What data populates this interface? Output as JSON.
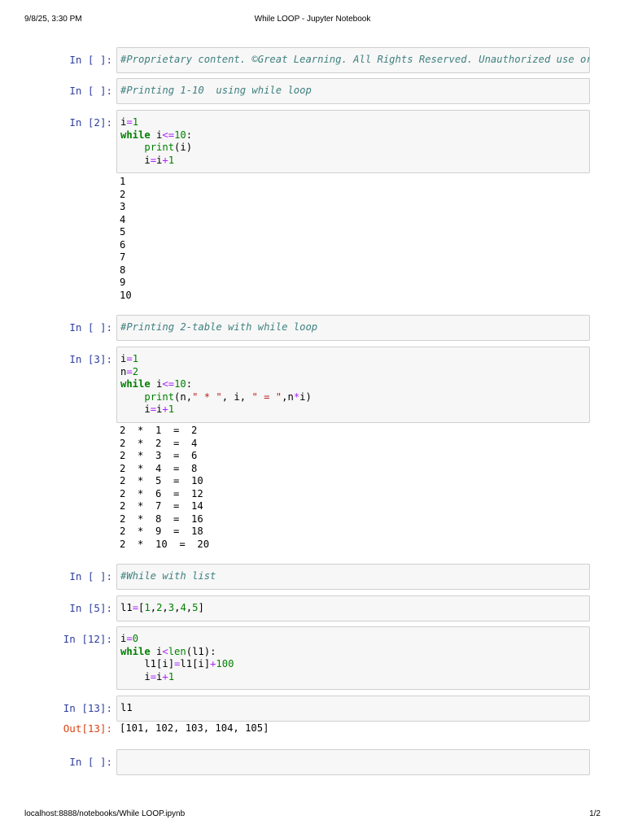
{
  "page_header": {
    "datetime": "9/8/25, 3:30 PM",
    "title": "While LOOP - Jupyter Notebook"
  },
  "page_footer": {
    "url": "localhost:8888/notebooks/While LOOP.ipynb",
    "page": "1/2"
  },
  "cells": [
    {
      "prompt": "In [ ]:",
      "code_tokens": [
        [
          [
            "cm",
            "#Proprietary content. ©Great Learning. All Rights Reserved. Unauthorized use or distribution prohibited"
          ]
        ]
      ]
    },
    {
      "prompt": "In [ ]:",
      "code_tokens": [
        [
          [
            "cm",
            "#Printing 1-10  using while loop"
          ]
        ]
      ]
    },
    {
      "prompt": "In [2]:",
      "code_tokens": [
        [
          [
            "nm",
            "i"
          ],
          [
            "op",
            "="
          ],
          [
            "num",
            "1"
          ]
        ],
        [
          [
            "kw",
            "while"
          ],
          [
            "nm",
            " i"
          ],
          [
            "op",
            "<="
          ],
          [
            "num",
            "10"
          ],
          [
            "nm",
            ":"
          ]
        ],
        [
          [
            "nm",
            "    "
          ],
          [
            "bi",
            "print"
          ],
          [
            "nm",
            "(i)"
          ]
        ],
        [
          [
            "nm",
            "    i"
          ],
          [
            "op",
            "="
          ],
          [
            "nm",
            "i"
          ],
          [
            "op",
            "+"
          ],
          [
            "num",
            "1"
          ]
        ]
      ],
      "output_lines": [
        "1",
        "2",
        "3",
        "4",
        "5",
        "6",
        "7",
        "8",
        "9",
        "10"
      ]
    },
    {
      "prompt": "In [ ]:",
      "code_tokens": [
        [
          [
            "cm",
            "#Printing 2-table with while loop"
          ]
        ]
      ]
    },
    {
      "prompt": "In [3]:",
      "code_tokens": [
        [
          [
            "nm",
            "i"
          ],
          [
            "op",
            "="
          ],
          [
            "num",
            "1"
          ]
        ],
        [
          [
            "nm",
            "n"
          ],
          [
            "op",
            "="
          ],
          [
            "num",
            "2"
          ]
        ],
        [
          [
            "kw",
            "while"
          ],
          [
            "nm",
            " i"
          ],
          [
            "op",
            "<="
          ],
          [
            "num",
            "10"
          ],
          [
            "nm",
            ":"
          ]
        ],
        [
          [
            "nm",
            "    "
          ],
          [
            "bi",
            "print"
          ],
          [
            "nm",
            "(n,"
          ],
          [
            "str",
            "\" * \""
          ],
          [
            "nm",
            ", i, "
          ],
          [
            "str",
            "\" = \""
          ],
          [
            "nm",
            ",n"
          ],
          [
            "op",
            "*"
          ],
          [
            "nm",
            "i)"
          ]
        ],
        [
          [
            "nm",
            "    i"
          ],
          [
            "op",
            "="
          ],
          [
            "nm",
            "i"
          ],
          [
            "op",
            "+"
          ],
          [
            "num",
            "1"
          ]
        ]
      ],
      "output_lines": [
        "2  *  1  =  2",
        "2  *  2  =  4",
        "2  *  3  =  6",
        "2  *  4  =  8",
        "2  *  5  =  10",
        "2  *  6  =  12",
        "2  *  7  =  14",
        "2  *  8  =  16",
        "2  *  9  =  18",
        "2  *  10  =  20"
      ]
    },
    {
      "prompt": "In [ ]:",
      "code_tokens": [
        [
          [
            "cm",
            "#While with list"
          ]
        ]
      ]
    },
    {
      "prompt": "In [5]:",
      "code_tokens": [
        [
          [
            "nm",
            "l1"
          ],
          [
            "op",
            "="
          ],
          [
            "nm",
            "["
          ],
          [
            "num",
            "1"
          ],
          [
            "nm",
            ","
          ],
          [
            "num",
            "2"
          ],
          [
            "nm",
            ","
          ],
          [
            "num",
            "3"
          ],
          [
            "nm",
            ","
          ],
          [
            "num",
            "4"
          ],
          [
            "nm",
            ","
          ],
          [
            "num",
            "5"
          ],
          [
            "nm",
            "]"
          ]
        ]
      ]
    },
    {
      "prompt": "In [12]:",
      "code_tokens": [
        [
          [
            "nm",
            "i"
          ],
          [
            "op",
            "="
          ],
          [
            "num",
            "0"
          ]
        ],
        [
          [
            "kw",
            "while"
          ],
          [
            "nm",
            " i"
          ],
          [
            "op",
            "<"
          ],
          [
            "bi",
            "len"
          ],
          [
            "nm",
            "(l1):"
          ]
        ],
        [
          [
            "nm",
            "    l1[i]"
          ],
          [
            "op",
            "="
          ],
          [
            "nm",
            "l1[i]"
          ],
          [
            "op",
            "+"
          ],
          [
            "num",
            "100"
          ]
        ],
        [
          [
            "nm",
            "    i"
          ],
          [
            "op",
            "="
          ],
          [
            "nm",
            "i"
          ],
          [
            "op",
            "+"
          ],
          [
            "num",
            "1"
          ]
        ]
      ]
    },
    {
      "prompt": "In [13]:",
      "code_tokens": [
        [
          [
            "nm",
            "l1"
          ]
        ]
      ],
      "out_prompt": "Out[13]:",
      "output_lines": [
        "[101, 102, 103, 104, 105]"
      ]
    },
    {
      "prompt": "In [ ]:",
      "code_tokens": [
        [
          [
            "nm",
            ""
          ]
        ]
      ]
    }
  ]
}
